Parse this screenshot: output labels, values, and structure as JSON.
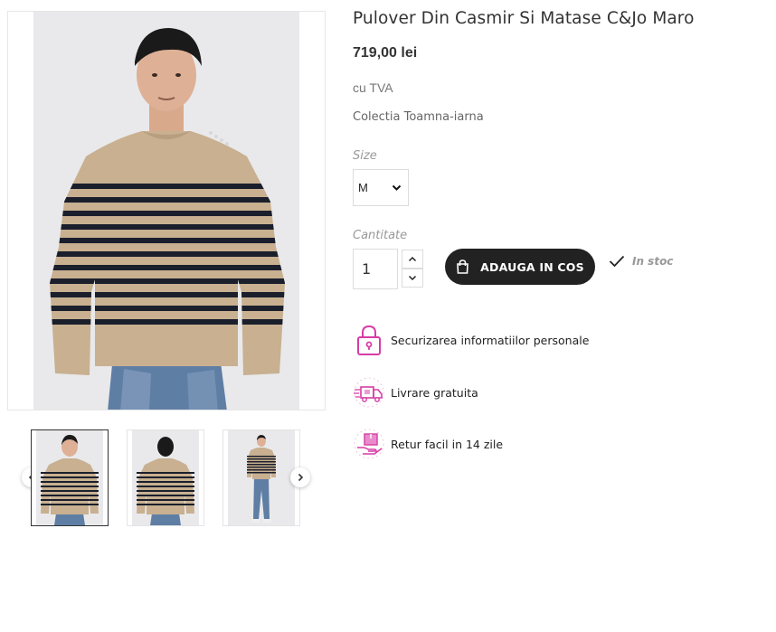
{
  "product": {
    "title": "Pulover Din Casmir Si Matase C&Jo Maro",
    "price": "719,00 lei",
    "tax_note": "cu TVA",
    "collection": "Colectia Toamna-iarna"
  },
  "size": {
    "label": "Size",
    "selected": "M"
  },
  "quantity": {
    "label": "Cantitate",
    "value": "1"
  },
  "cart": {
    "button_label": "ADAUGA IN COS"
  },
  "stock": {
    "label": "In stoc"
  },
  "benefits": [
    {
      "text": "Securizarea informatiilor personale",
      "icon": "padlock-icon"
    },
    {
      "text": "Livrare gratuita",
      "icon": "delivery-truck-icon"
    },
    {
      "text": "Retur facil in 14 zile",
      "icon": "return-box-icon"
    }
  ],
  "gallery": {
    "thumbnails": [
      "front-view",
      "back-view",
      "full-body-view"
    ],
    "active_index": 0
  },
  "colors": {
    "accent_pink": "#d63ca6",
    "button_dark": "#222222",
    "sweater_beige": "#c8b090",
    "stripe_navy": "#1b1f2c"
  }
}
